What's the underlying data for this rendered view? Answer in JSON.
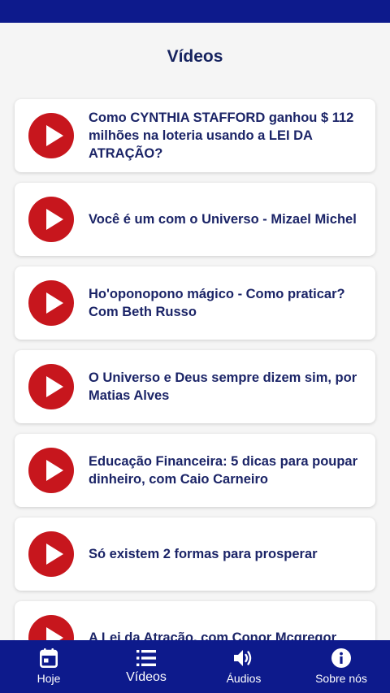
{
  "header": {
    "title": "Vídeos"
  },
  "videos": [
    {
      "title": "Como CYNTHIA STAFFORD ganhou $ 112 milhões na loteria usando a LEI DA ATRAÇÃO?",
      "icon": "play-icon"
    },
    {
      "title": "Você é um com o Universo - Mizael Michel",
      "icon": "play-icon"
    },
    {
      "title": "Ho'oponopono mágico - Como praticar? Com Beth Russo",
      "icon": "play-icon"
    },
    {
      "title": "O Universo e Deus sempre dizem sim, por Matias Alves",
      "icon": "play-icon"
    },
    {
      "title": "Educação Financeira: 5 dicas para poupar dinheiro, com Caio Carneiro",
      "icon": "play-icon"
    },
    {
      "title": "Só existem 2 formas para prosperar",
      "icon": "play-icon"
    },
    {
      "title": "A Lei da Atração, com Conor Mcgregor",
      "icon": "play-icon"
    }
  ],
  "nav": {
    "items": [
      {
        "label": "Hoje",
        "icon": "calendar-icon"
      },
      {
        "label": "Vídeos",
        "icon": "list-icon",
        "active": true
      },
      {
        "label": "Áudios",
        "icon": "speaker-icon"
      },
      {
        "label": "Sobre nós",
        "icon": "info-icon"
      }
    ]
  },
  "colors": {
    "primary": "#0d1a8c",
    "play_button": "#c7161d",
    "title_text": "#1b2467",
    "background": "#f5f5f5"
  }
}
